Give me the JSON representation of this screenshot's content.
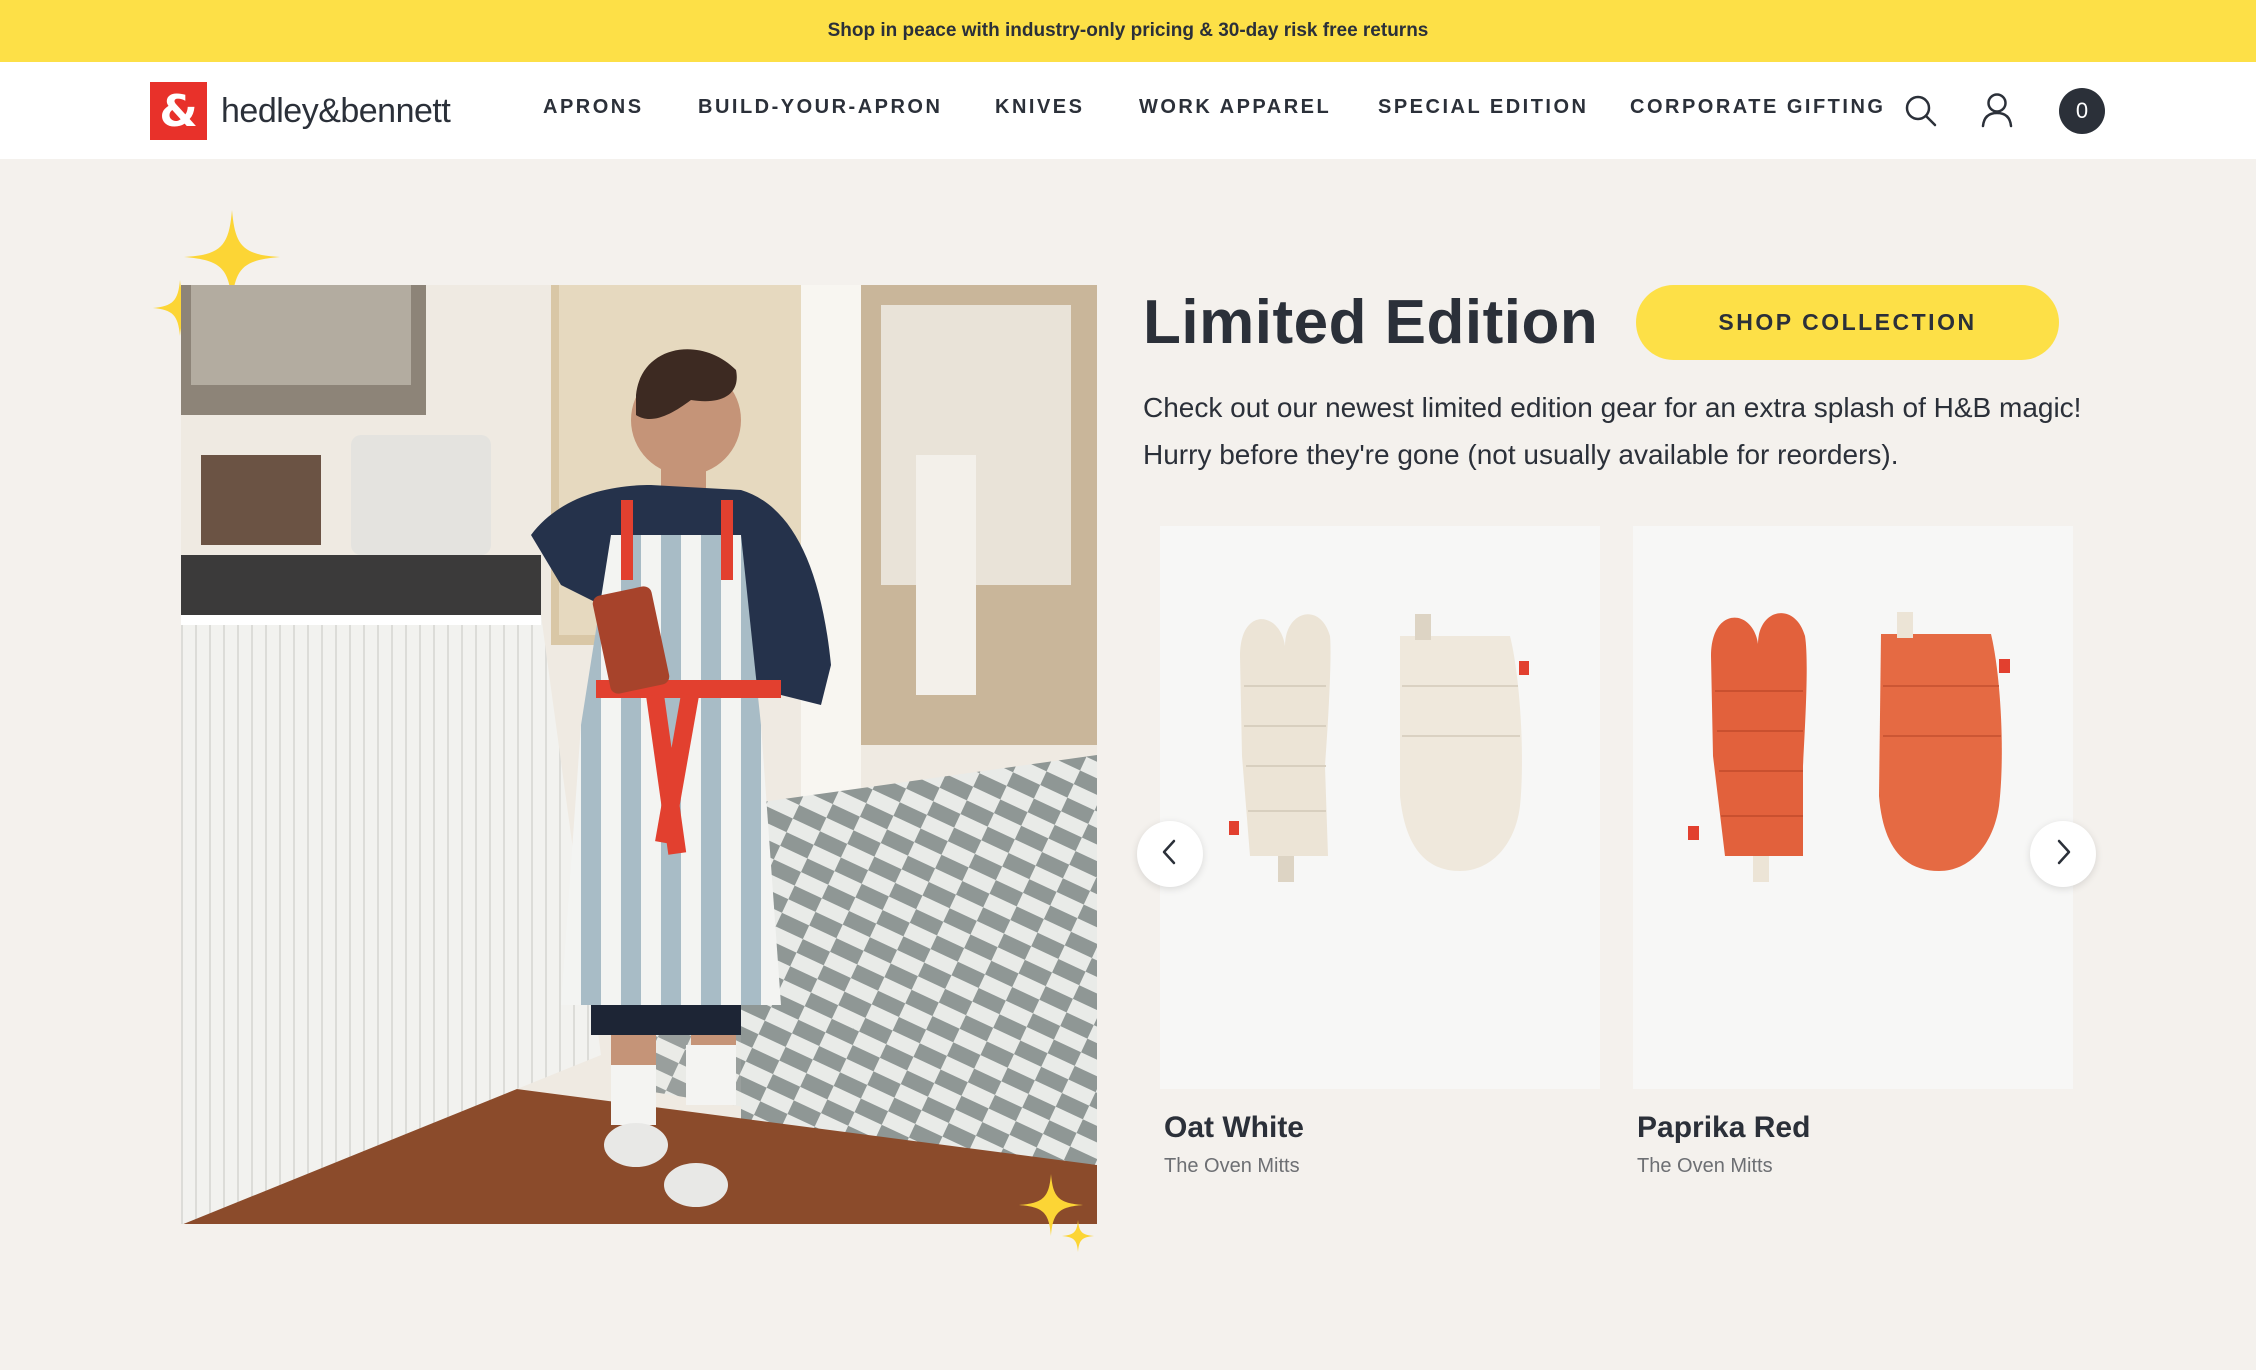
{
  "announcement": {
    "text": "Shop in peace with industry-only pricing & 30-day risk free returns"
  },
  "header": {
    "logo_mark": "&",
    "logo_text": "hedley&bennett",
    "nav": [
      "APRONS",
      "BUILD-YOUR-APRON",
      "KNIVES",
      "WORK APPAREL",
      "SPECIAL EDITION",
      "CORPORATE GIFTING"
    ],
    "icons": [
      "search-icon",
      "account-icon",
      "cart-icon"
    ],
    "cart_count": "0"
  },
  "hero": {
    "title": "Limited Edition",
    "cta_label": "SHOP COLLECTION",
    "description": "Check out our newest limited edition gear for an extra splash of H&B magic! Hurry before they're gone (not usually available for reorders)."
  },
  "products": [
    {
      "name": "Oat White",
      "subtitle": "The Oven Mitts",
      "color": "#ece4d6"
    },
    {
      "name": "Paprika Red",
      "subtitle": "The Oven Mitts",
      "color": "#e2613c"
    }
  ],
  "colors": {
    "accent_yellow": "#fde047",
    "brand_red": "#e8312a",
    "text_dark": "#2b3039",
    "page_bg": "#f4f1ed"
  }
}
